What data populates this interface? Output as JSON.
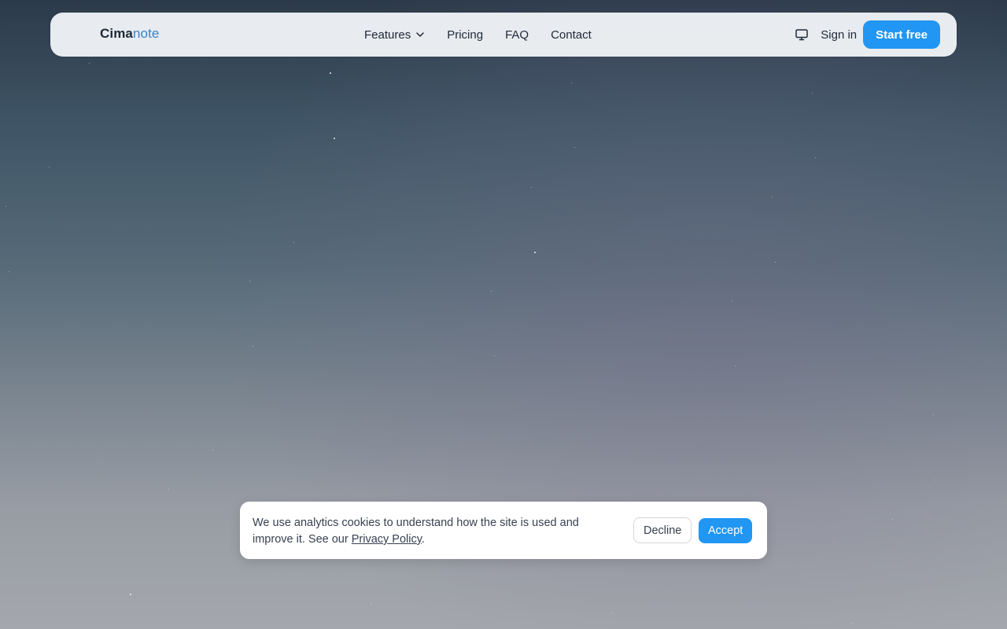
{
  "brand": {
    "name_part1": "Cima",
    "name_part2": "note",
    "accent_color": "#3b82c4"
  },
  "nav": {
    "features_label": "Features",
    "pricing_label": "Pricing",
    "faq_label": "FAQ",
    "contact_label": "Contact"
  },
  "header_actions": {
    "theme_icon": "monitor-icon",
    "signin_label": "Sign in",
    "start_label": "Start free",
    "primary_color": "#2196f3"
  },
  "cookie_banner": {
    "message": "We use analytics cookies to understand how the site is used and improve it. See our ",
    "policy_link": "Privacy Policy",
    "message_end": ".",
    "decline_label": "Decline",
    "accept_label": "Accept"
  }
}
